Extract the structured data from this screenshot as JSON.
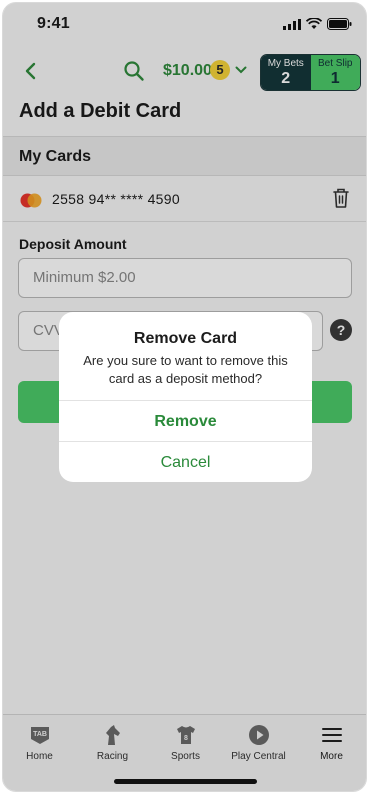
{
  "status_bar": {
    "time": "9:41"
  },
  "header": {
    "balance": "$10.00",
    "balance_badge": "5",
    "my_bets": {
      "label": "My Bets",
      "count": "2"
    },
    "bet_slip": {
      "label": "Bet Slip",
      "count": "1"
    }
  },
  "page": {
    "title": "Add a Debit Card"
  },
  "my_cards": {
    "section_title": "My Cards",
    "cards": [
      {
        "brand_icon": "mastercard-icon",
        "number": "2558 94** **** 4590"
      }
    ]
  },
  "form": {
    "deposit_label": "Deposit Amount",
    "amount_placeholder": "Minimum $2.00",
    "cvv_placeholder": "CVV"
  },
  "dialog": {
    "title": "Remove Card",
    "message": "Are you sure to want to remove this card as a deposit method?",
    "remove_label": "Remove",
    "cancel_label": "Cancel"
  },
  "tabbar": {
    "items": [
      {
        "label": "Home",
        "icon": "tab-logo-icon"
      },
      {
        "label": "Racing",
        "icon": "horse-head-icon"
      },
      {
        "label": "Sports",
        "icon": "jersey-icon"
      },
      {
        "label": "Play Central",
        "icon": "play-icon"
      },
      {
        "label": "More",
        "icon": "hamburger-menu-icon"
      }
    ]
  },
  "colors": {
    "accent_green": "#4cc969",
    "dark_teal": "#14373a",
    "link_green": "#2a8a3a"
  }
}
